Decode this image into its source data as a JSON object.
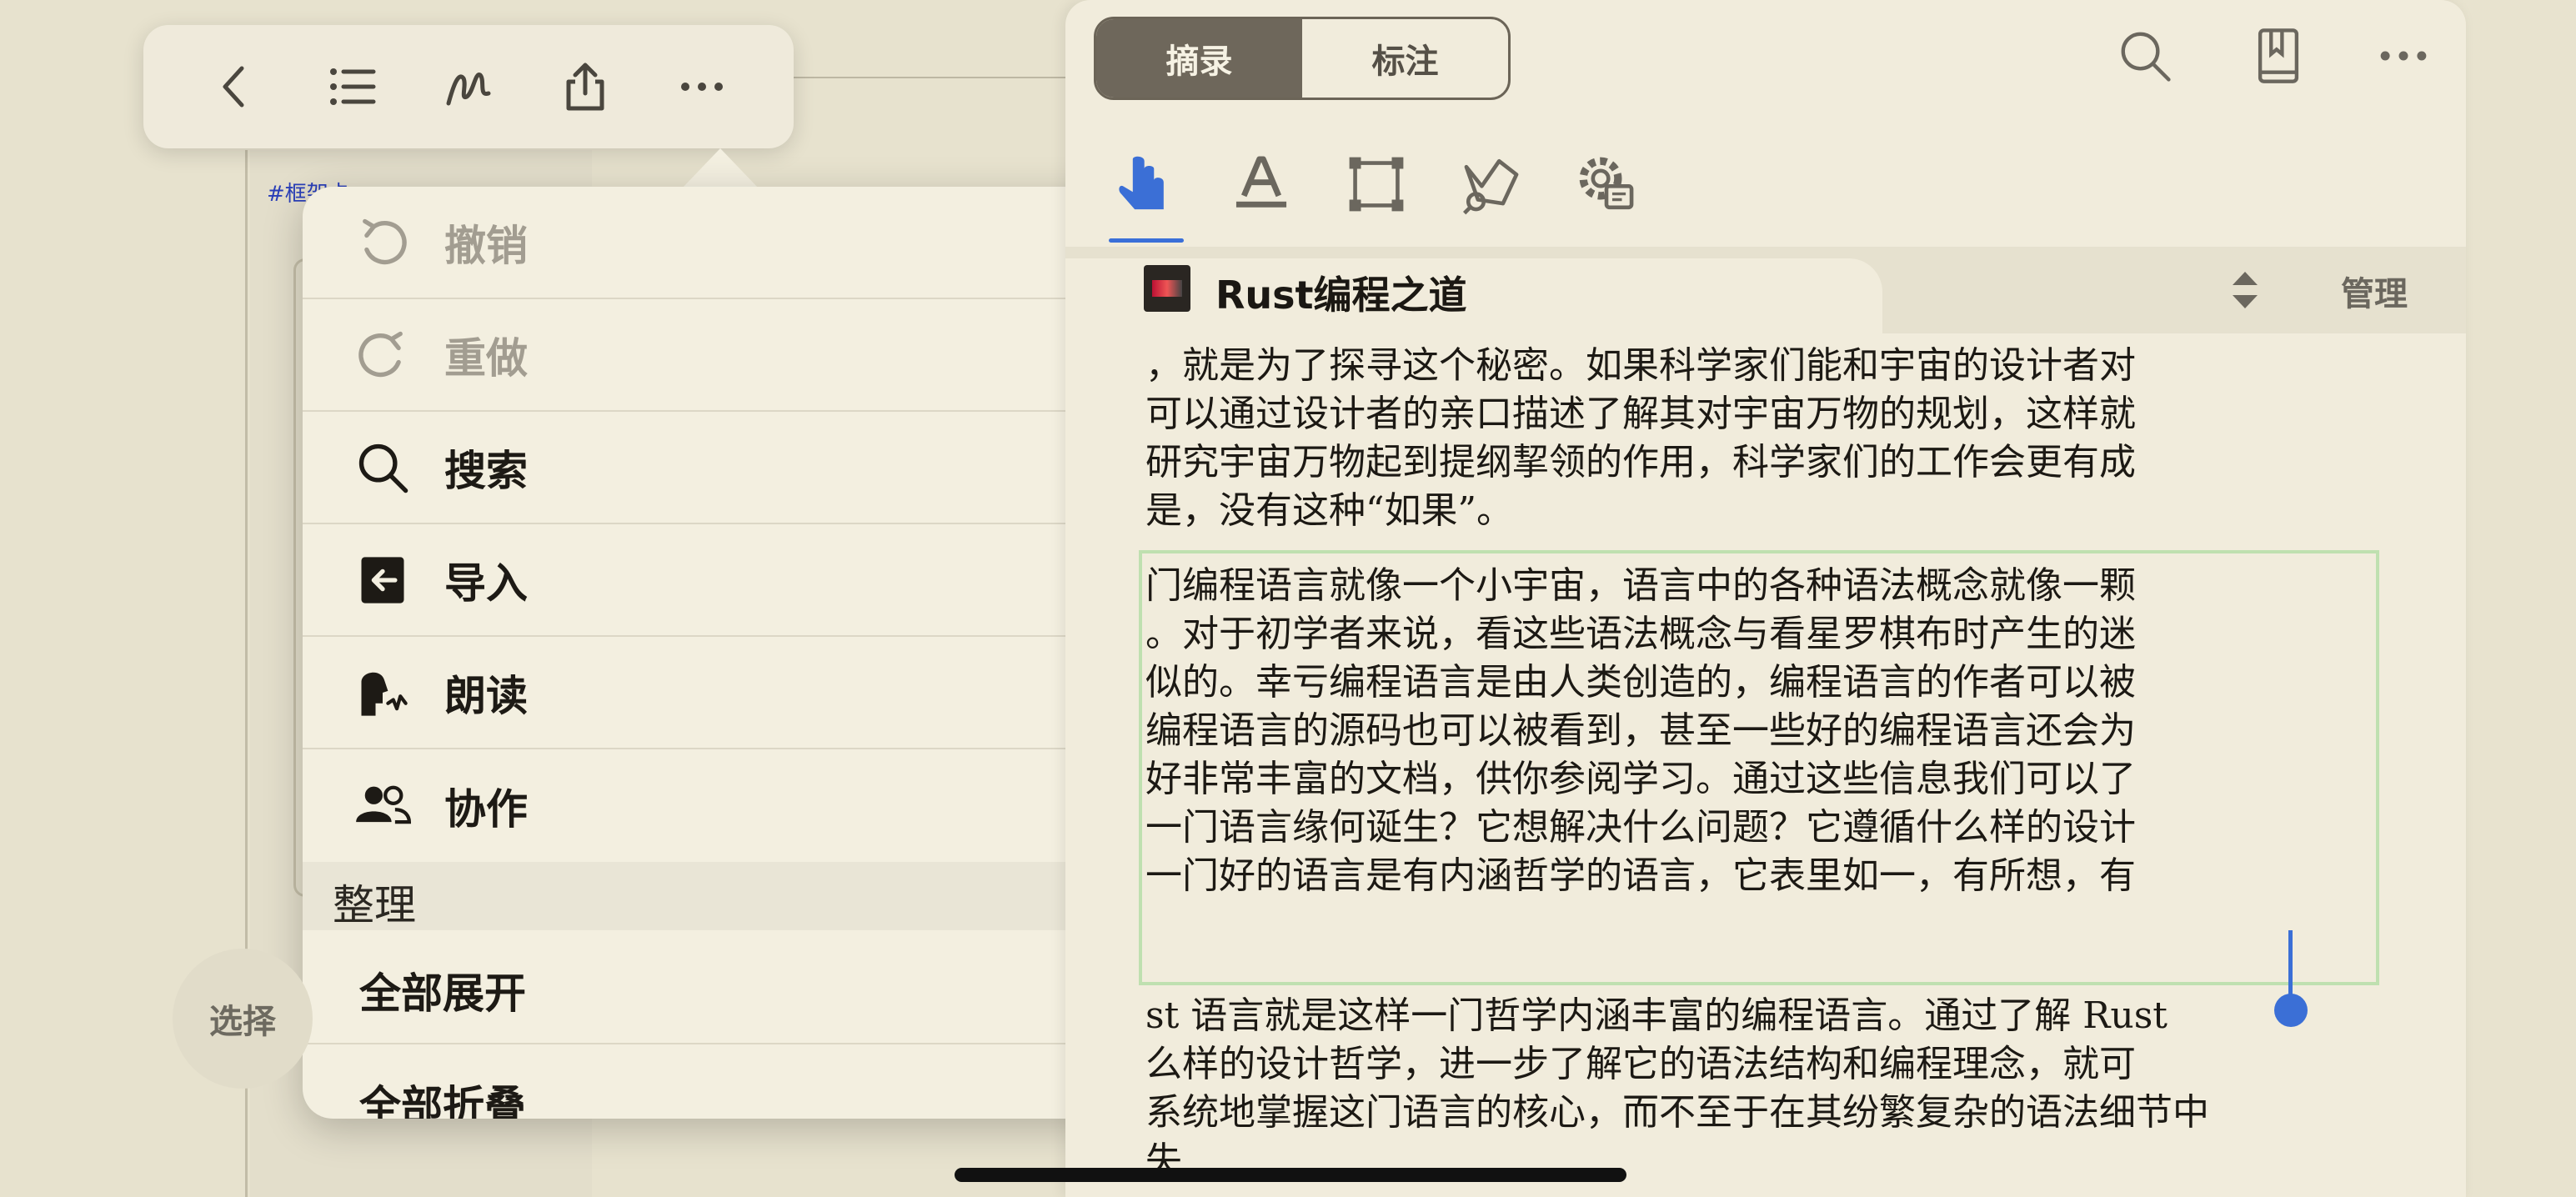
{
  "canvas": {
    "tag": "#框架卡"
  },
  "toolbar": {
    "icons": [
      "back-chevron-icon",
      "outline-list-icon",
      "scribble-icon",
      "share-icon",
      "more-icon"
    ]
  },
  "menu": {
    "items": [
      {
        "label": "撤销",
        "icon": "undo-icon",
        "disabled": true
      },
      {
        "label": "重做",
        "icon": "redo-icon",
        "disabled": true
      },
      {
        "label": "搜索",
        "icon": "search-icon",
        "disabled": false
      },
      {
        "label": "导入",
        "icon": "import-icon",
        "disabled": false
      },
      {
        "label": "朗读",
        "icon": "read-aloud-icon",
        "disabled": false
      },
      {
        "label": "协作",
        "icon": "collaborate-icon",
        "disabled": false
      }
    ],
    "section_label": "整理",
    "sub_items": [
      "全部展开",
      "全部折叠"
    ]
  },
  "select_button": "选择",
  "right_panel": {
    "segments": {
      "active": "摘录",
      "inactive": "标注"
    },
    "top_icons": [
      "search-icon",
      "bookmark-book-icon",
      "more-icon"
    ],
    "tools": [
      "hand-pointer-icon",
      "text-highlight-icon",
      "rect-select-icon",
      "lasso-icon",
      "settings-gear-icon"
    ],
    "book_title": "Rust编程之道",
    "manage_label": "管理",
    "text_lines": [
      "，就是为了探寻这个秘密。如果科学家们能和宇宙的设计者对",
      "可以通过设计者的亲口描述了解其对宇宙万物的规划，这样就",
      "研究宇宙万物起到提纲挈领的作用，科学家们的工作会更有成",
      "是，没有这种“如果”。",
      "门编程语言就像一个小宇宙，语言中的各种语法概念就像一颗",
      "。对于初学者来说，看这些语法概念与看星罗棋布时产生的迷",
      "似的。幸亏编程语言是由人类创造的，编程语言的作者可以被",
      "编程语言的源码也可以被看到，甚至一些好的编程语言还会为",
      "好非常丰富的文档，供你参阅学习。通过这些信息我们可以了",
      "一门语言缘何诞生？它想解决什么问题？它遵循什么样的设计",
      "一门好的语言是有内涵哲学的语言，它表里如一，有所想，有",
      "st 语言就是这样一门哲学内涵丰富的编程语言。通过了解 Rust",
      "么样的设计哲学，进一步了解它的语法结构和编程理念，就可",
      "系统地掌握这门语言的核心，而不至于在其纷繁复杂的语法细节中",
      "失"
    ]
  },
  "colors": {
    "accent_blue": "#3b6fd6",
    "highlight_green": "#bfe0b0",
    "segment_active": "#6e675b"
  }
}
